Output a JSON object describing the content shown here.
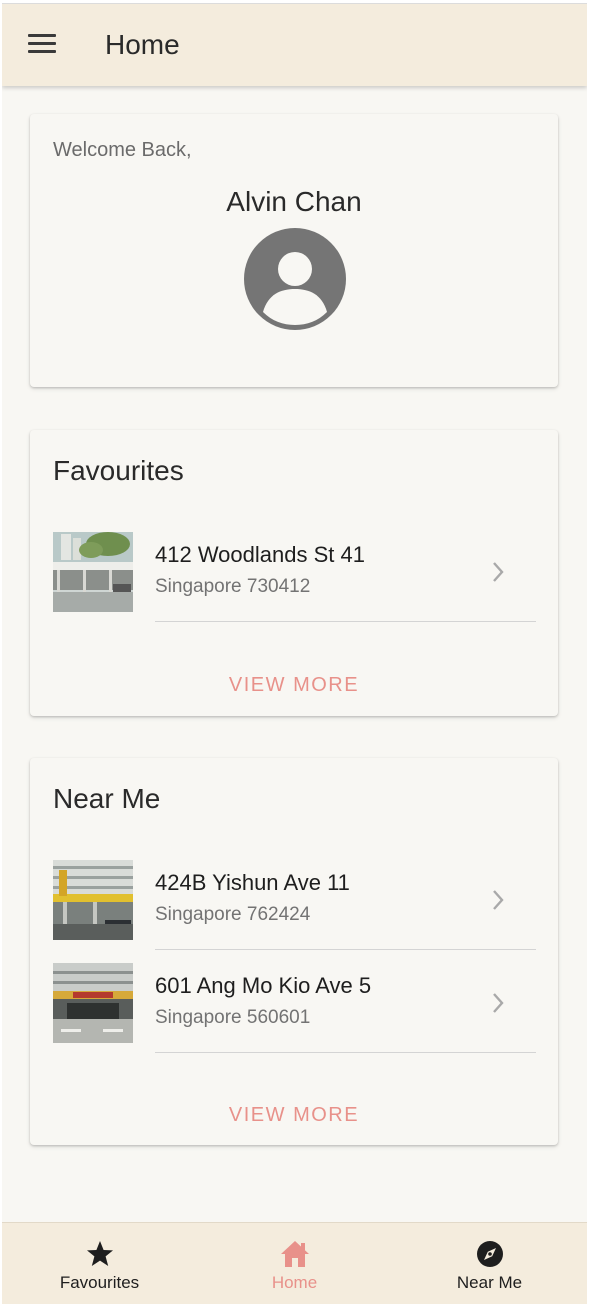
{
  "header": {
    "title": "Home",
    "menu_icon": "hamburger-menu-icon"
  },
  "welcome": {
    "greeting": "Welcome Back,",
    "name": "Alvin Chan",
    "avatar_icon": "account-circle-icon"
  },
  "favourites": {
    "title": "Favourites",
    "items": [
      {
        "title": "412 Woodlands St 41",
        "subtitle": "Singapore 730412"
      }
    ],
    "view_more": "VIEW MORE"
  },
  "near_me": {
    "title": "Near Me",
    "items": [
      {
        "title": "424B Yishun Ave 11",
        "subtitle": "Singapore 762424"
      },
      {
        "title": "601 Ang Mo Kio Ave 5",
        "subtitle": "Singapore 560601"
      }
    ],
    "view_more": "VIEW MORE"
  },
  "bottom_nav": {
    "items": [
      {
        "label": "Favourites",
        "icon": "star-icon"
      },
      {
        "label": "Home",
        "icon": "home-icon",
        "active": true
      },
      {
        "label": "Near Me",
        "icon": "compass-icon"
      }
    ]
  },
  "colors": {
    "app_bar": "#f4ecdd",
    "background": "#f8f7f3",
    "accent": "#e8918a",
    "avatar": "#757575"
  }
}
